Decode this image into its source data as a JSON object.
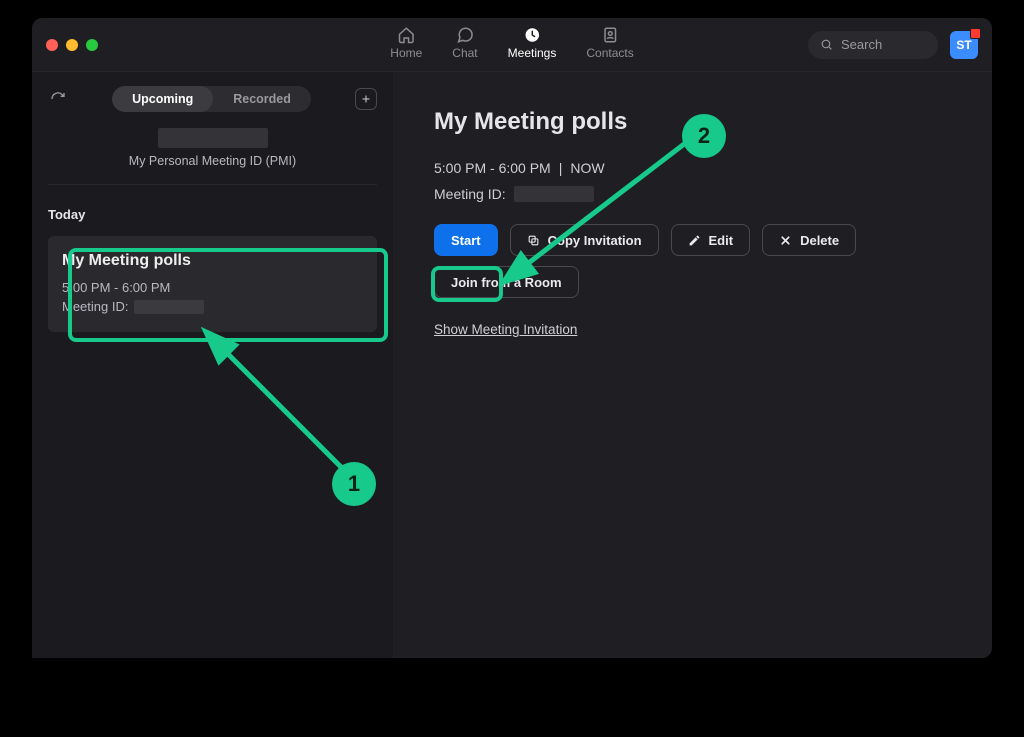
{
  "nav": {
    "home": "Home",
    "chat": "Chat",
    "meetings": "Meetings",
    "contacts": "Contacts"
  },
  "search": {
    "placeholder": "Search"
  },
  "avatar": {
    "initials": "ST"
  },
  "sidebar": {
    "tabs": {
      "upcoming": "Upcoming",
      "recorded": "Recorded"
    },
    "pmi_label": "My Personal Meeting ID (PMI)",
    "today_label": "Today",
    "meeting": {
      "title": "My Meeting polls",
      "time": "5:00 PM - 6:00 PM",
      "id_label": "Meeting ID:"
    }
  },
  "main": {
    "title": "My Meeting polls",
    "time": "5:00 PM - 6:00 PM",
    "now_sep": "|",
    "now": "NOW",
    "id_label": "Meeting ID:",
    "buttons": {
      "start": "Start",
      "copy": "Copy Invitation",
      "edit": "Edit",
      "delete": "Delete",
      "join_room": "Join from a Room"
    },
    "show_invitation": "Show Meeting Invitation"
  },
  "annotations": {
    "one": "1",
    "two": "2"
  }
}
